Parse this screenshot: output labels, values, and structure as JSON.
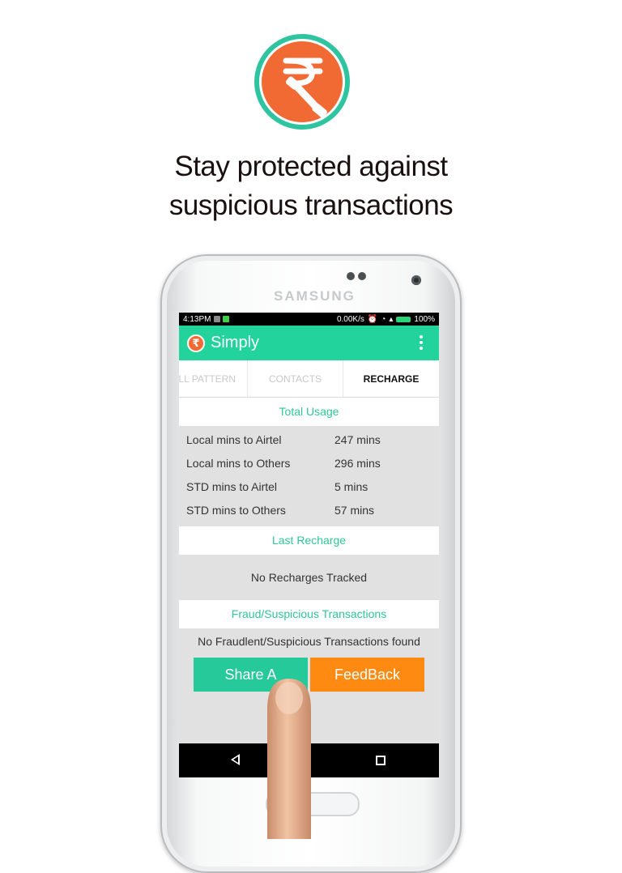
{
  "hero": {
    "logo_icon": "rupee-phone-logo-icon",
    "headline_line1": "Stay protected against",
    "headline_line2": "suspicious transactions"
  },
  "device": {
    "brand": "SAMSUNG"
  },
  "statusbar": {
    "time": "4:13PM",
    "network_speed": "0.00K/s",
    "battery": "100%"
  },
  "appbar": {
    "icon": "rupee-icon",
    "icon_glyph": "₹",
    "title": "Simply",
    "overflow_icon": "overflow-menu-icon"
  },
  "tabs": [
    {
      "label": "LL PATTERN",
      "active": false
    },
    {
      "label": "CONTACTS",
      "active": false
    },
    {
      "label": "RECHARGE",
      "active": true
    }
  ],
  "total_usage": {
    "header": "Total Usage",
    "rows": [
      {
        "label": "Local mins to Airtel",
        "value": "247 mins"
      },
      {
        "label": "Local mins to Others",
        "value": "296 mins"
      },
      {
        "label": "STD mins to Airtel",
        "value": "5 mins"
      },
      {
        "label": "STD mins to Others",
        "value": "57 mins"
      }
    ]
  },
  "last_recharge": {
    "header": "Last Recharge",
    "message": "No Recharges Tracked"
  },
  "fraud": {
    "header": "Fraud/Suspicious Transactions",
    "message": "No Fraudlent/Suspicious Transactions found"
  },
  "buttons": {
    "share_label": "Share A",
    "feedback_label": "FeedBack"
  },
  "colors": {
    "accent_green": "#22d39c",
    "brand_orange": "#f26a33",
    "feedback_orange": "#ff8a12"
  }
}
